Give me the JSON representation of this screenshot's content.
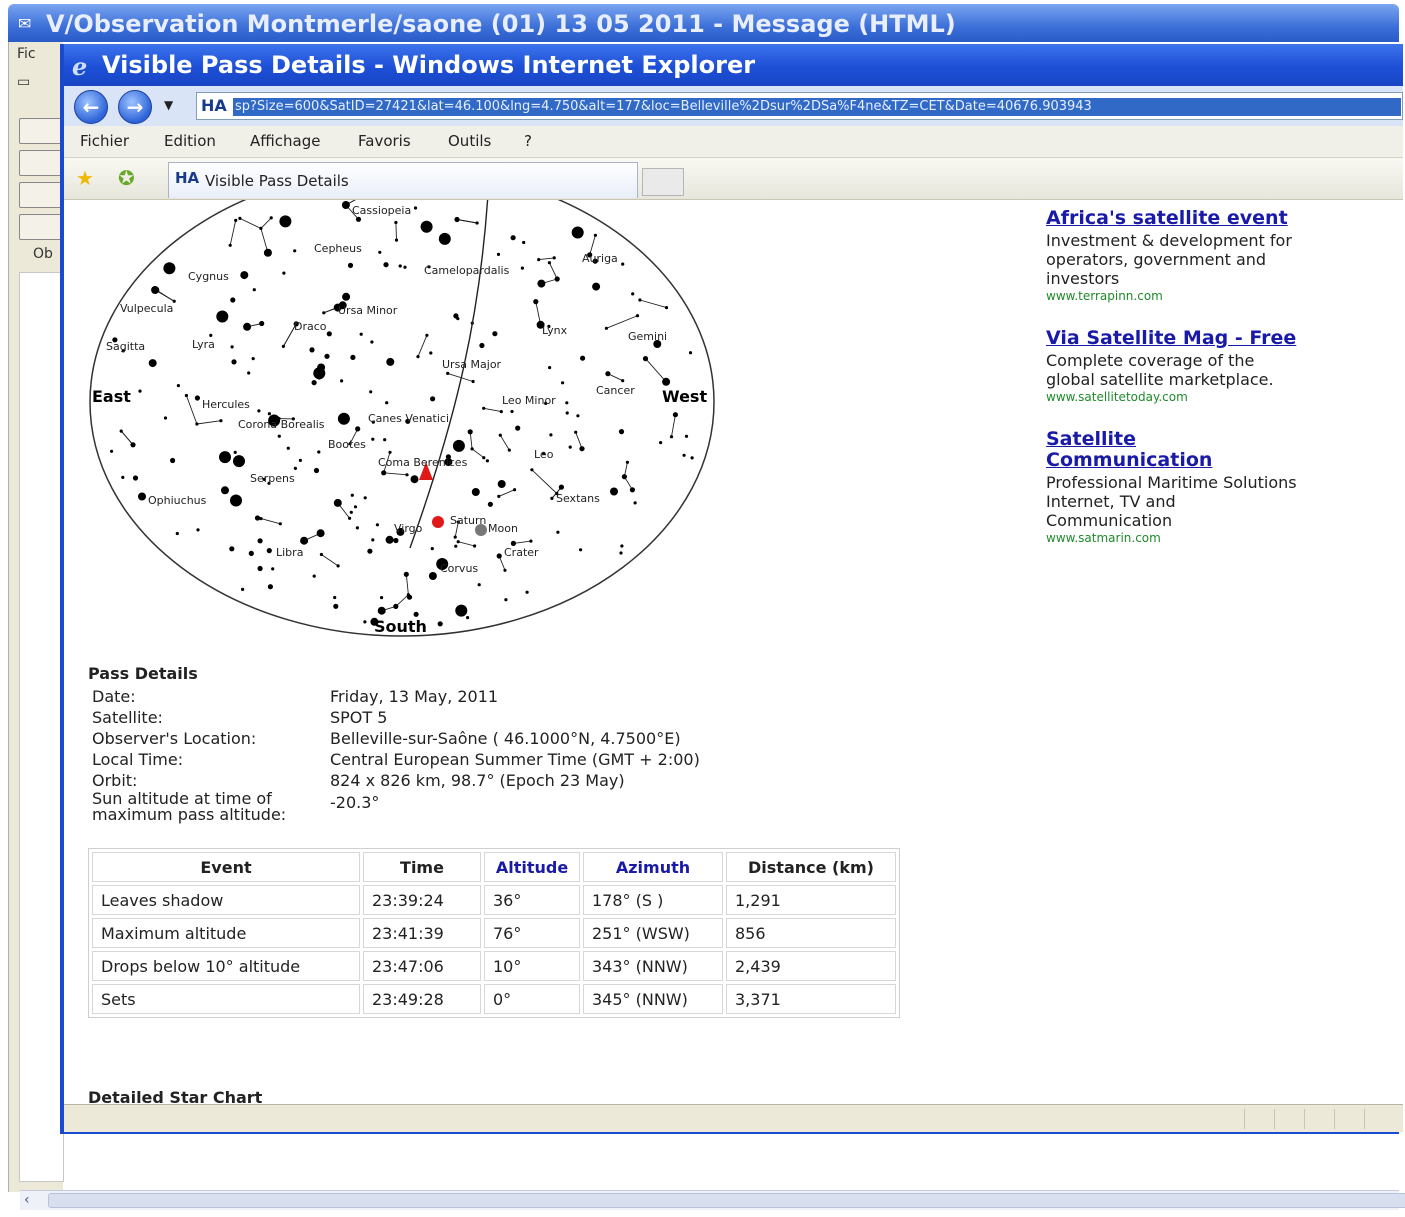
{
  "outer_window": {
    "title": "V/Observation Montmerle/saone (01) 13 05 2011 - Message (HTML)",
    "left_menu_fragment": "Fic",
    "left_label_fragment": "Ob"
  },
  "browser": {
    "title": "Visible Pass Details - Windows Internet Explorer",
    "url": "sp?Size=600&SatID=27421&lat=46.100&lng=4.750&alt=177&loc=Belleville%2Dsur%2DSa%F4ne&TZ=CET&Date=40676.903943",
    "menu": [
      "Fichier",
      "Edition",
      "Affichage",
      "Favoris",
      "Outils",
      "?"
    ],
    "tab_label": "Visible Pass Details",
    "favicon": "HA"
  },
  "sky_chart": {
    "directions": {
      "east": "East",
      "west": "West",
      "south": "South"
    },
    "constellations": [
      "Cassiopeia",
      "Cepheus",
      "Camelopardalis",
      "Cygnus",
      "Auriga",
      "Vulpecula",
      "Ursa Minor",
      "Draco",
      "Lynx",
      "Sagitta",
      "Lyra",
      "Gemini",
      "Ursa Major",
      "Hercules",
      "Leo Minor",
      "Cancer",
      "Corona Borealis",
      "Canes Venatici",
      "Bootes",
      "Coma Berenices",
      "Leo",
      "Serpens",
      "Ophiuchus",
      "Sextans",
      "Saturn",
      "Moon",
      "Virgo",
      "Libra",
      "Crater",
      "Corvus"
    ]
  },
  "ads": [
    {
      "title": "Africa's satellite event",
      "body": "Investment & development for operators, government and investors",
      "url": "www.terrapinn.com"
    },
    {
      "title": "Via Satellite Mag - Free",
      "body": "Complete coverage of the global satellite marketplace.",
      "url": "www.satellitetoday.com"
    },
    {
      "title": "Satellite Communication",
      "body": "Professional Maritime Solutions Internet, TV and Communication",
      "url": "www.satmarin.com"
    }
  ],
  "pass_details": {
    "title": "Pass Details",
    "rows": [
      {
        "label": "Date:",
        "value": "Friday, 13 May, 2011"
      },
      {
        "label": "Satellite:",
        "value": "SPOT 5"
      },
      {
        "label": "Observer's Location:",
        "value": "Belleville-sur-Saône ( 46.1000°N, 4.7500°E)"
      },
      {
        "label": "Local Time:",
        "value": "Central European Summer Time (GMT + 2:00)"
      },
      {
        "label": "Orbit:",
        "value": "824 x 826 km, 98.7° (Epoch 23 May)"
      },
      {
        "label": "Sun altitude at time of maximum pass altitude:",
        "value": "-20.3°"
      }
    ]
  },
  "events_table": {
    "headers": [
      "Event",
      "Time",
      "Altitude",
      "Azimuth",
      "Distance (km)"
    ],
    "rows": [
      [
        "Leaves shadow",
        "23:39:24",
        "36°",
        "178° (S )",
        "1,291"
      ],
      [
        "Maximum altitude",
        "23:41:39",
        "76°",
        "251° (WSW)",
        "856"
      ],
      [
        "Drops below 10° altitude",
        "23:47:06",
        "10°",
        "343° (NNW)",
        "2,439"
      ],
      [
        "Sets",
        "23:49:28",
        "0°",
        "345° (NNW)",
        "3,371"
      ]
    ]
  },
  "detailed_star_chart": {
    "title": "Detailed Star Chart"
  },
  "colors": {
    "title_bar": "#1d4fd6",
    "link": "#1a1aa8",
    "ad_url": "#1f8a2a",
    "satellite_marker": "#e01818"
  }
}
